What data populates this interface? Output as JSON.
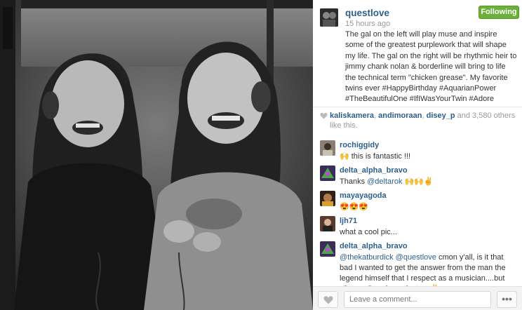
{
  "post": {
    "username": "questlove",
    "time_ago": "15 hours ago",
    "follow_label": "Following",
    "caption": "The gal on the left will play muse and inspire some of the greatest purplework that will shape my life. The gal on the right will be rhythmic heir to jimmy chank nolan & borderline will bring to life the technical term \"chicken grease\". My favorite twins ever #HappyBirthday #AquarianPower #TheBeautifulOne #IfIWasYourTwin #Adore"
  },
  "likes": {
    "users": [
      "kaliskamera",
      "andimoraan",
      "disey_p"
    ],
    "sep1": ", ",
    "sep2": ", ",
    "suffix": " and 3,580 others like this."
  },
  "comments": [
    {
      "user": "rochiggidy",
      "text": "🙌 this is fantastic !!!"
    },
    {
      "user": "delta_alpha_bravo",
      "pre": "Thanks ",
      "mention": "@deltarok",
      "post": " 🙌🙌✌"
    },
    {
      "user": "mayayagoda",
      "text": "😍😍😍"
    },
    {
      "user": "ljh71",
      "text": "what a cool pic..."
    },
    {
      "user": "delta_alpha_bravo",
      "mention1": "@thekatburdick",
      "mention2": "@questlove",
      "post": " cmon y'all, is it that bad I wanted to get the answer from the man the legend himself that I respect as a musician....but y'know, Google works too ✌"
    }
  ],
  "footer": {
    "comment_placeholder": "Leave a comment...",
    "more_label": "•••"
  },
  "colors": {
    "link": "#2d5f8b",
    "follow_green": "#6bb038"
  }
}
